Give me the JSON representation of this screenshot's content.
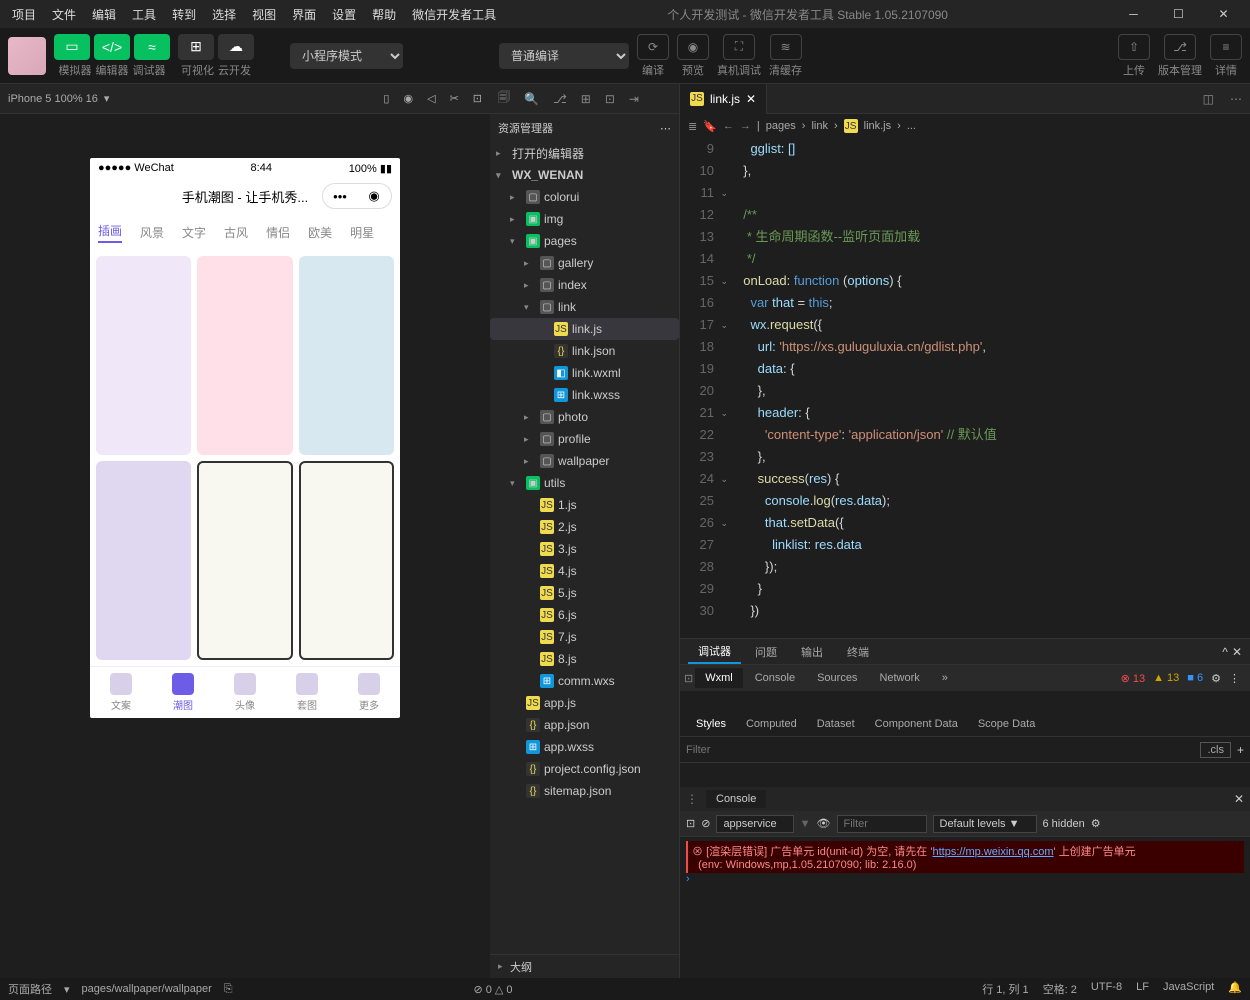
{
  "window": {
    "menus": [
      "项目",
      "文件",
      "编辑",
      "工具",
      "转到",
      "选择",
      "视图",
      "界面",
      "设置",
      "帮助",
      "微信开发者工具"
    ],
    "title": "个人开发测试 - 微信开发者工具 Stable 1.05.2107090"
  },
  "toolbar": {
    "labels": {
      "simulator": "模拟器",
      "editor": "编辑器",
      "debugger": "调试器",
      "visualize": "可视化",
      "cloud": "云开发"
    },
    "mode_select": "小程序模式",
    "compile_select": "普通编译",
    "actions": {
      "compile": "编译",
      "preview": "预览",
      "realdebug": "真机调试",
      "clearcache": "清缓存",
      "upload": "上传",
      "version": "版本管理",
      "detail": "详情"
    }
  },
  "sim": {
    "device": "iPhone 5 100% 16",
    "dropdown": "▾"
  },
  "phone": {
    "status_left": "●●●●● WeChat",
    "status_time": "8:44",
    "status_right": "100%",
    "header": "手机潮图 - 让手机秀...",
    "tabs": [
      "插画",
      "风景",
      "文字",
      "古风",
      "情侣",
      "欧美",
      "明星"
    ],
    "nav": [
      "文案",
      "潮图",
      "头像",
      "套图",
      "更多"
    ]
  },
  "explorer": {
    "title": "资源管理器",
    "sections": {
      "opened": "打开的编辑器",
      "project": "WX_WENAN",
      "outline": "大纲"
    },
    "tree": [
      {
        "d": 1,
        "t": "folder",
        "n": "colorui",
        "exp": false
      },
      {
        "d": 1,
        "t": "page",
        "n": "img",
        "exp": false
      },
      {
        "d": 1,
        "t": "page",
        "n": "pages",
        "exp": true
      },
      {
        "d": 2,
        "t": "folder",
        "n": "gallery",
        "exp": false
      },
      {
        "d": 2,
        "t": "folder",
        "n": "index",
        "exp": false
      },
      {
        "d": 2,
        "t": "folder",
        "n": "link",
        "exp": true
      },
      {
        "d": 3,
        "t": "js",
        "n": "link.js",
        "sel": true
      },
      {
        "d": 3,
        "t": "json",
        "n": "link.json"
      },
      {
        "d": 3,
        "t": "wxml",
        "n": "link.wxml"
      },
      {
        "d": 3,
        "t": "wxss",
        "n": "link.wxss"
      },
      {
        "d": 2,
        "t": "folder",
        "n": "photo",
        "exp": false
      },
      {
        "d": 2,
        "t": "folder",
        "n": "profile",
        "exp": false
      },
      {
        "d": 2,
        "t": "folder",
        "n": "wallpaper",
        "exp": false
      },
      {
        "d": 1,
        "t": "page",
        "n": "utils",
        "exp": true
      },
      {
        "d": 2,
        "t": "js",
        "n": "1.js"
      },
      {
        "d": 2,
        "t": "js",
        "n": "2.js"
      },
      {
        "d": 2,
        "t": "js",
        "n": "3.js"
      },
      {
        "d": 2,
        "t": "js",
        "n": "4.js"
      },
      {
        "d": 2,
        "t": "js",
        "n": "5.js"
      },
      {
        "d": 2,
        "t": "js",
        "n": "6.js"
      },
      {
        "d": 2,
        "t": "js",
        "n": "7.js"
      },
      {
        "d": 2,
        "t": "js",
        "n": "8.js"
      },
      {
        "d": 2,
        "t": "wxss",
        "n": "comm.wxs"
      },
      {
        "d": 1,
        "t": "js",
        "n": "app.js"
      },
      {
        "d": 1,
        "t": "json",
        "n": "app.json"
      },
      {
        "d": 1,
        "t": "wxss",
        "n": "app.wxss"
      },
      {
        "d": 1,
        "t": "json",
        "n": "project.config.json"
      },
      {
        "d": 1,
        "t": "json",
        "n": "sitemap.json"
      }
    ]
  },
  "editor": {
    "tab": "link.js",
    "breadcrumb": [
      "pages",
      "link",
      "link.js",
      "..."
    ],
    "lines": [
      9,
      10,
      11,
      12,
      13,
      14,
      15,
      16,
      17,
      18,
      19,
      20,
      21,
      22,
      23,
      24,
      25,
      26,
      27,
      28,
      29,
      30
    ],
    "code": {
      "l9": "gglist: []",
      "l10": "},",
      "l12": "/**",
      "l13": " * 生命周期函数--监听页面加载",
      "l14": " */",
      "l15a": "onLoad",
      "l15b": "function",
      "l15c": "options",
      "l16a": "var",
      "l16b": "that",
      "l16c": "this",
      "l17": "wx.request({",
      "l18a": "url:",
      "l18b": "'https://xs.guluguluxia.cn/gdlist.php'",
      "l19": "data: {",
      "l20": "},",
      "l21": "header: {",
      "l22a": "'content-type'",
      "l22b": "'application/json'",
      "l22c": "// 默认值",
      "l23": "},",
      "l24a": "success",
      "l24b": "res",
      "l25": "console.log(res.data);",
      "l26": "that.setData({",
      "l27": "linklist: res.data",
      "l28": "});",
      "l29": "}",
      "l30": "})"
    }
  },
  "debugger": {
    "tabs": [
      "调试器",
      "问题",
      "输出",
      "终端"
    ],
    "devtabs": [
      "Wxml",
      "Console",
      "Sources",
      "Network"
    ],
    "badges": {
      "err": "13",
      "warn": "13",
      "info": "6"
    },
    "styletabs": [
      "Styles",
      "Computed",
      "Dataset",
      "Component Data",
      "Scope Data"
    ],
    "cls": ".cls",
    "filter_ph": "Filter",
    "console_tab": "Console",
    "appservice": "appservice",
    "levels": "Default levels",
    "hidden": "6 hidden",
    "error_pre": "[渲染层错误] 广告单元 id(unit-id) 为空, 请先在 '",
    "error_link": "https://mp.weixin.qq.com",
    "error_post": "' 上创建广告单元",
    "error_env": "(env: Windows,mp,1.05.2107090; lib: 2.16.0)"
  },
  "status": {
    "path_label": "页面路径",
    "path": "pages/wallpaper/wallpaper",
    "stats": "⊘ 0 △ 0",
    "line": "行 1, 列 1",
    "spaces": "空格: 2",
    "enc": "UTF-8",
    "eol": "LF",
    "lang": "JavaScript"
  }
}
